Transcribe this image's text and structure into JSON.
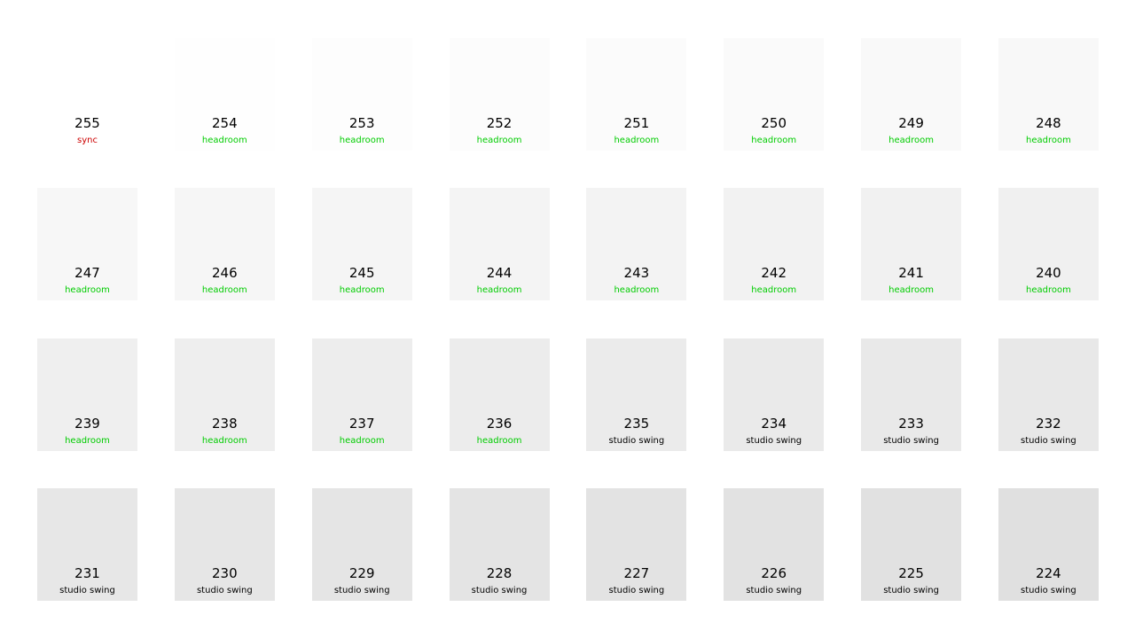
{
  "colors": {
    "sync": "#cc0000",
    "headroom": "#00cc00",
    "studio_swing": "#000000"
  },
  "swatches": [
    {
      "value": "255",
      "label": "sync",
      "kind": "sync"
    },
    {
      "value": "254",
      "label": "headroom",
      "kind": "headroom"
    },
    {
      "value": "253",
      "label": "headroom",
      "kind": "headroom"
    },
    {
      "value": "252",
      "label": "headroom",
      "kind": "headroom"
    },
    {
      "value": "251",
      "label": "headroom",
      "kind": "headroom"
    },
    {
      "value": "250",
      "label": "headroom",
      "kind": "headroom"
    },
    {
      "value": "249",
      "label": "headroom",
      "kind": "headroom"
    },
    {
      "value": "248",
      "label": "headroom",
      "kind": "headroom"
    },
    {
      "value": "247",
      "label": "headroom",
      "kind": "headroom"
    },
    {
      "value": "246",
      "label": "headroom",
      "kind": "headroom"
    },
    {
      "value": "245",
      "label": "headroom",
      "kind": "headroom"
    },
    {
      "value": "244",
      "label": "headroom",
      "kind": "headroom"
    },
    {
      "value": "243",
      "label": "headroom",
      "kind": "headroom"
    },
    {
      "value": "242",
      "label": "headroom",
      "kind": "headroom"
    },
    {
      "value": "241",
      "label": "headroom",
      "kind": "headroom"
    },
    {
      "value": "240",
      "label": "headroom",
      "kind": "headroom"
    },
    {
      "value": "239",
      "label": "headroom",
      "kind": "headroom"
    },
    {
      "value": "238",
      "label": "headroom",
      "kind": "headroom"
    },
    {
      "value": "237",
      "label": "headroom",
      "kind": "headroom"
    },
    {
      "value": "236",
      "label": "headroom",
      "kind": "headroom"
    },
    {
      "value": "235",
      "label": "studio swing",
      "kind": "studio_swing"
    },
    {
      "value": "234",
      "label": "studio swing",
      "kind": "studio_swing"
    },
    {
      "value": "233",
      "label": "studio swing",
      "kind": "studio_swing"
    },
    {
      "value": "232",
      "label": "studio swing",
      "kind": "studio_swing"
    },
    {
      "value": "231",
      "label": "studio swing",
      "kind": "studio_swing"
    },
    {
      "value": "230",
      "label": "studio swing",
      "kind": "studio_swing"
    },
    {
      "value": "229",
      "label": "studio swing",
      "kind": "studio_swing"
    },
    {
      "value": "228",
      "label": "studio swing",
      "kind": "studio_swing"
    },
    {
      "value": "227",
      "label": "studio swing",
      "kind": "studio_swing"
    },
    {
      "value": "226",
      "label": "studio swing",
      "kind": "studio_swing"
    },
    {
      "value": "225",
      "label": "studio swing",
      "kind": "studio_swing"
    },
    {
      "value": "224",
      "label": "studio swing",
      "kind": "studio_swing"
    }
  ]
}
